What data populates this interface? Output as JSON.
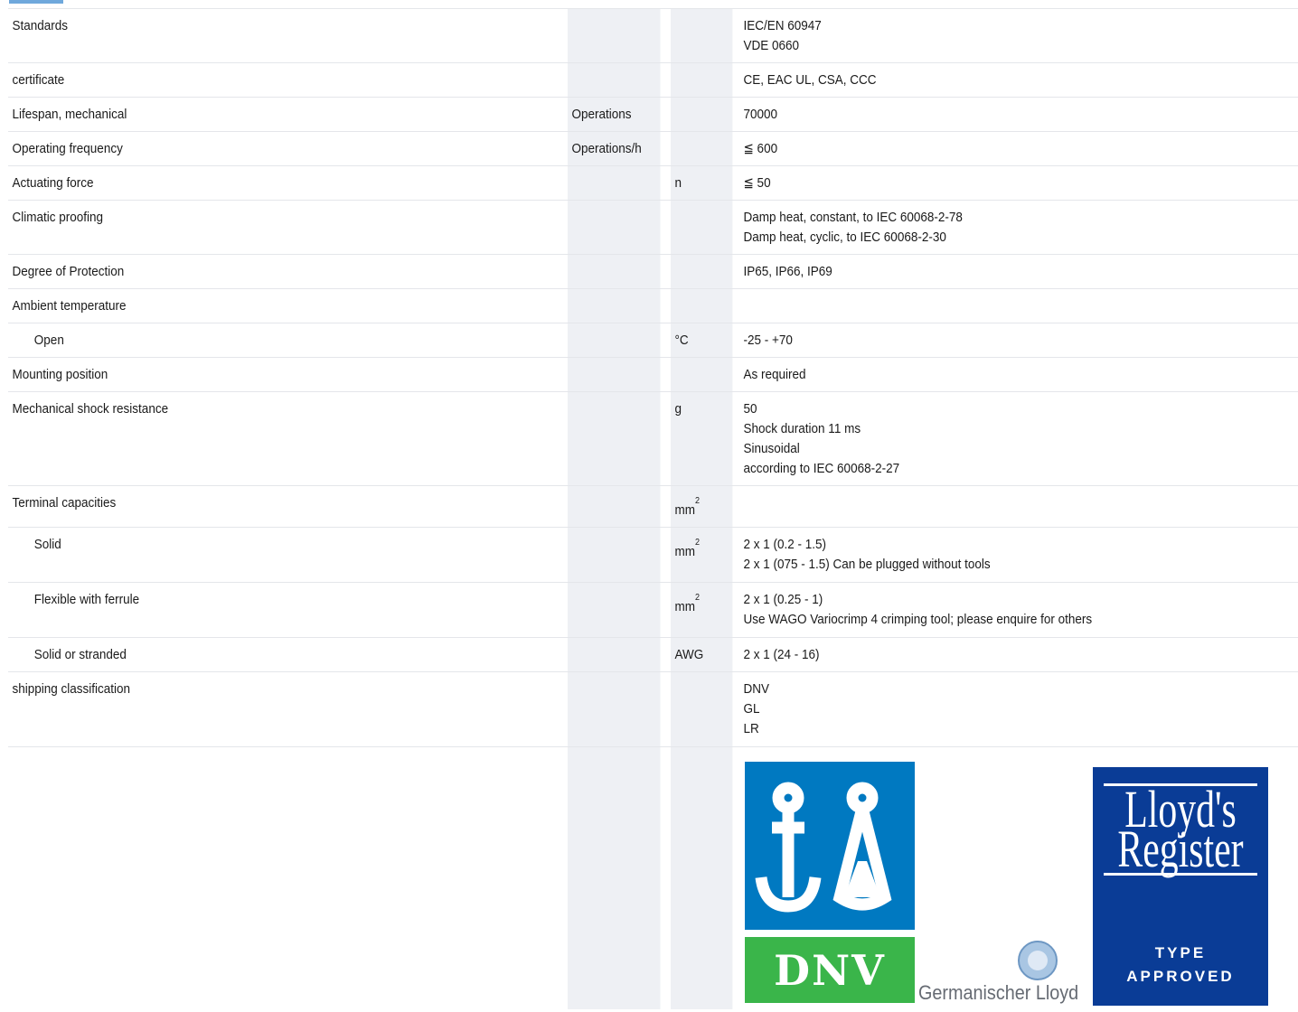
{
  "rows": [
    {
      "label": "Standards",
      "unit_name": "",
      "unit_sym": "",
      "value": [
        "IEC/EN 60947",
        "VDE 0660"
      ],
      "indent": false
    },
    {
      "label": "certificate",
      "unit_name": "",
      "unit_sym": "",
      "value": [
        "CE, EAC UL, CSA, CCC"
      ],
      "indent": false
    },
    {
      "label": "Lifespan, mechanical",
      "unit_name": "Operations",
      "unit_sym": "",
      "value": [
        "70000"
      ],
      "indent": false
    },
    {
      "label": "Operating frequency",
      "unit_name": "Operations/h",
      "unit_sym": "",
      "value": [
        "≦ 600"
      ],
      "indent": false
    },
    {
      "label": "Actuating force",
      "unit_name": "",
      "unit_sym": "n",
      "value": [
        "≦ 50"
      ],
      "indent": false
    },
    {
      "label": "Climatic proofing",
      "unit_name": "",
      "unit_sym": "",
      "value": [
        "Damp heat, constant, to IEC 60068-2-78",
        "Damp heat, cyclic, to IEC 60068-2-30"
      ],
      "indent": false
    },
    {
      "label": "Degree of Protection",
      "unit_name": "",
      "unit_sym": "",
      "value": [
        "IP65, IP66, IP69"
      ],
      "indent": false
    },
    {
      "label": "Ambient temperature",
      "unit_name": "",
      "unit_sym": "",
      "value": [],
      "indent": false
    },
    {
      "label": "Open",
      "unit_name": "",
      "unit_sym": "°C",
      "value": [
        "-25 - +70"
      ],
      "indent": true
    },
    {
      "label": "Mounting position",
      "unit_name": "",
      "unit_sym": "",
      "value": [
        "As required"
      ],
      "indent": false
    },
    {
      "label": "Mechanical shock resistance",
      "unit_name": "",
      "unit_sym": "g",
      "value": [
        "50",
        "Shock duration 11 ms",
        "Sinusoidal",
        "according to IEC 60068-2-27"
      ],
      "indent": false
    },
    {
      "label": "Terminal capacities",
      "unit_name": "",
      "unit_sym": "mm",
      "unit_sup": "2",
      "value": [],
      "indent": false
    },
    {
      "label": "Solid",
      "unit_name": "",
      "unit_sym": "mm",
      "unit_sup": "2",
      "value": [
        "2 x 1 (0.2 - 1.5)",
        "2 x 1 (075 - 1.5) Can be plugged without tools"
      ],
      "indent": true
    },
    {
      "label": "Flexible with ferrule",
      "unit_name": "",
      "unit_sym": "mm",
      "unit_sup": "2",
      "value": [
        "2 x 1 (0.25 - 1)",
        "Use WAGO Variocrimp 4 crimping tool; please enquire for others"
      ],
      "indent": true
    },
    {
      "label": "Solid or stranded",
      "unit_name": "",
      "unit_sym": "AWG",
      "value": [
        "2 x 1 (24 - 16)"
      ],
      "indent": true
    },
    {
      "label": "shipping classification",
      "unit_name": "",
      "unit_sym": "",
      "value": [
        "DNV",
        "GL",
        "LR"
      ],
      "indent": false
    }
  ],
  "logos": {
    "dnv_text": "DNV",
    "gl_text": "Germanischer Lloyd",
    "lr_line1": "Lloyd's",
    "lr_line2": "Register",
    "lr_type": "TYPE",
    "lr_approved": "APPROVED"
  },
  "colors": {
    "dnv_blue": "#0079c1",
    "dnv_green": "#3ab54a",
    "lr_blue": "#0a3c96",
    "unit_column_bg": "#eef0f4"
  }
}
